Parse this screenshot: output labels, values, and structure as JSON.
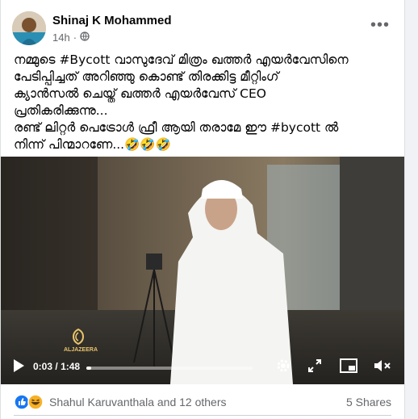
{
  "post": {
    "author": "Shinaj K Mohammed",
    "time": "14h",
    "privacy_icon": "globe-icon",
    "menu_icon": "more-dots-icon",
    "text_lines": [
      "നമ്മുടെ #Bycott വാസുദേവ് മിത്രം ഖത്തർ എയർവേസിനെ",
      "പേടിപ്പിച്ചത് അറിഞ്ഞു കൊണ്ട് തിരക്കിട്ട മീറ്റിംഗ്",
      "ക്യാൻസൽ ചെയ്ത് ഖത്തർ എയർവേസ് CEO",
      "പ്രതികരിക്കുന്നു...",
      "രണ്ട് ലിറ്റർ പെട്രോൾ ഫ്രീ ആയി തരാമേ ഈ #bycott ൽ",
      "നിന്ന് പിന്മാറണേ...🤣🤣🤣"
    ]
  },
  "video": {
    "current_time": "0:03",
    "duration": "1:48",
    "separator": "/",
    "progress": 0.028,
    "watermark": "ALJAZEERA",
    "icons": [
      "play-icon",
      "settings-gear-icon",
      "fullscreen-icon",
      "miniplayer-icon",
      "mute-icon"
    ]
  },
  "footer": {
    "reaction_names": "Shahul Karuvanthala and 12 others",
    "shares": "5 Shares"
  },
  "colors": {
    "like_blue": "#1877f2",
    "haha_yellow": "#f7b125"
  }
}
